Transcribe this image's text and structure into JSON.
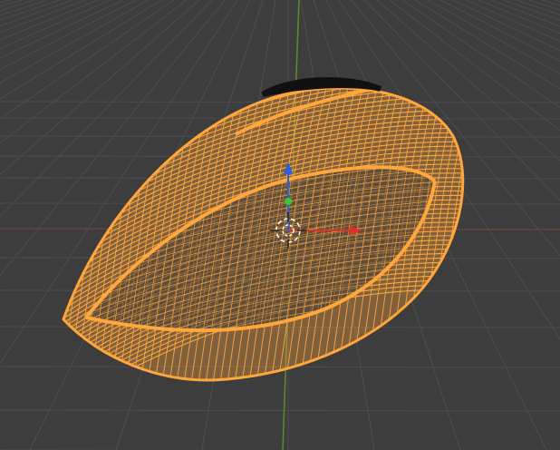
{
  "viewport": {
    "background_color": "#3d3d3d",
    "grid_color": "#4d4d4d",
    "x_axis_color": "#8a3a3a",
    "y_axis_color": "#5f8a2f",
    "z_axis_color": "#2a5f8a",
    "selection_color": "#ffa63c"
  },
  "object": {
    "mode": "wireframe",
    "selected": true
  },
  "gizmo": {
    "x_color": "#e0302b",
    "y_color": "#3ec43e",
    "z_color": "#2b5fe0",
    "icon": "3d-cursor-icon"
  }
}
